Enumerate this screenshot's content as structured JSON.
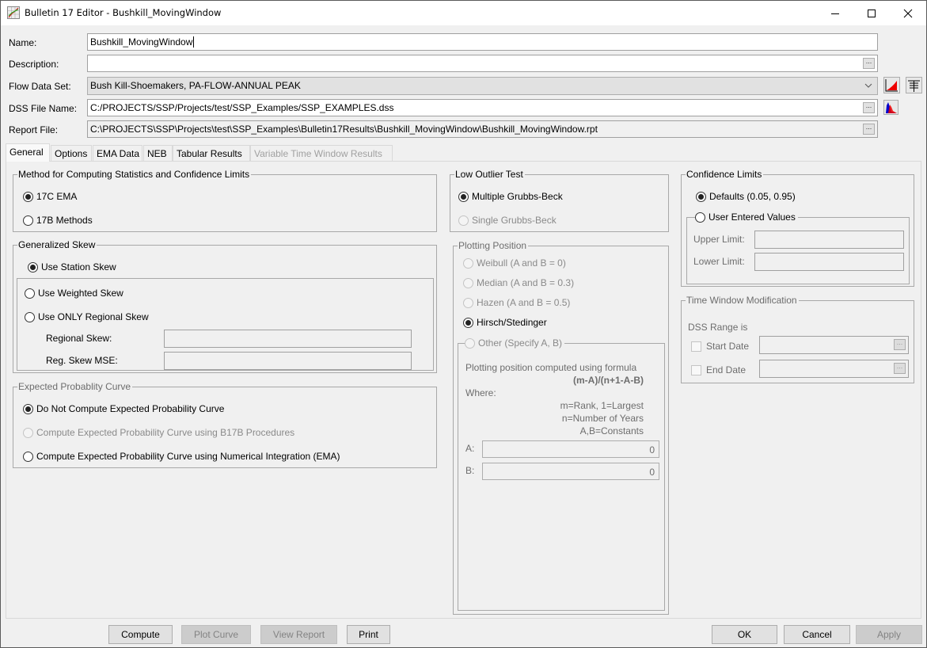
{
  "window": {
    "title": "Bulletin 17 Editor - Bushkill_MovingWindow",
    "icon": "chart-app-icon",
    "controls": [
      "minimize",
      "maximize",
      "close"
    ]
  },
  "header": {
    "name_label": "Name:",
    "name_value": "Bushkill_MovingWindow",
    "description_label": "Description:",
    "description_value": "",
    "flow_label": "Flow Data Set:",
    "flow_value": "Bush Kill-Shoemakers, PA-FLOW-ANNUAL PEAK",
    "dss_label": "DSS File Name:",
    "dss_value": "C:/PROJECTS/SSP/Projects/test/SSP_Examples/SSP_EXAMPLES.dss",
    "report_label": "Report File:",
    "report_value": "C:\\PROJECTS\\SSP\\Projects\\test\\SSP_Examples\\Bulletin17Results\\Bushkill_MovingWindow\\Bushkill_MovingWindow.rpt",
    "browse_label": "...",
    "icons": [
      "plot-data-icon",
      "table-icon",
      "distribution-icon"
    ]
  },
  "tabs": [
    {
      "label": "General",
      "active": true,
      "enabled": true
    },
    {
      "label": "Options",
      "active": false,
      "enabled": true
    },
    {
      "label": "EMA Data",
      "active": false,
      "enabled": true
    },
    {
      "label": "NEB",
      "active": false,
      "enabled": true
    },
    {
      "label": "Tabular Results",
      "active": false,
      "enabled": true
    },
    {
      "label": "Variable Time Window Results",
      "active": false,
      "enabled": false
    }
  ],
  "method": {
    "title": "Method for Computing Statistics and Confidence Limits",
    "options": [
      {
        "label": "17C EMA",
        "selected": true
      },
      {
        "label": "17B Methods",
        "selected": false
      }
    ]
  },
  "skew": {
    "title": "Generalized Skew",
    "options": [
      {
        "label": "Use Station Skew",
        "selected": true
      },
      {
        "label": "Use Weighted Skew",
        "selected": false
      },
      {
        "label": "Use ONLY Regional Skew",
        "selected": false
      }
    ],
    "regional_skew_label": "Regional Skew:",
    "regional_skew_value": "",
    "reg_mse_label": "Reg. Skew MSE:",
    "reg_mse_value": ""
  },
  "expected": {
    "title": "Expected Probablity Curve",
    "options": [
      {
        "label": "Do Not Compute Expected Probability Curve",
        "selected": true,
        "enabled": true
      },
      {
        "label": "Compute Expected Probability Curve using B17B Procedures",
        "selected": false,
        "enabled": false
      },
      {
        "label": "Compute Expected Probability Curve using Numerical Integration (EMA)",
        "selected": false,
        "enabled": true
      }
    ]
  },
  "low_outlier": {
    "title": "Low Outlier Test",
    "options": [
      {
        "label": "Multiple Grubbs-Beck",
        "selected": true,
        "enabled": true
      },
      {
        "label": "Single Grubbs-Beck",
        "selected": false,
        "enabled": false
      }
    ]
  },
  "plotting": {
    "title": "Plotting Position",
    "options": [
      {
        "label": "Weibull (A and B = 0)",
        "selected": false
      },
      {
        "label": "Median (A and B = 0.3)",
        "selected": false
      },
      {
        "label": "Hazen (A and B = 0.5)",
        "selected": false
      },
      {
        "label": "Hirsch/Stedinger",
        "selected": true
      }
    ],
    "other_label": "Other (Specify A, B)",
    "formula_intro": "Plotting position computed using formula",
    "formula": "(m-A)/(n+1-A-B)",
    "where": "Where:",
    "def_m": "m=Rank, 1=Largest",
    "def_n": "n=Number of Years",
    "def_ab": "A,B=Constants",
    "a_label": "A:",
    "a_value": "0",
    "b_label": "B:",
    "b_value": "0"
  },
  "confidence": {
    "title": "Confidence Limits",
    "defaults_label": "Defaults (0.05, 0.95)",
    "defaults_selected": true,
    "user_label": "User Entered Values",
    "upper_label": "Upper Limit:",
    "upper_value": "",
    "lower_label": "Lower Limit:",
    "lower_value": ""
  },
  "time_window": {
    "title": "Time Window Modification",
    "dss_range": "DSS Range is",
    "start_label": "Start Date",
    "start_value": "",
    "end_label": "End Date",
    "end_value": ""
  },
  "footer": {
    "compute": "Compute",
    "plot_curve": "Plot Curve",
    "view_report": "View Report",
    "print": "Print",
    "ok": "OK",
    "cancel": "Cancel",
    "apply": "Apply"
  }
}
